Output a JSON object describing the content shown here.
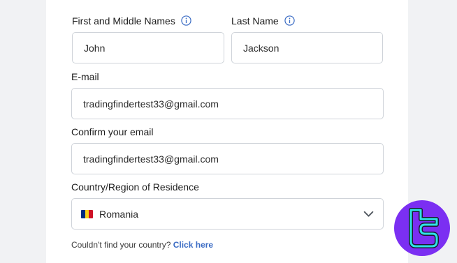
{
  "form": {
    "first_name": {
      "label": "First and Middle Names",
      "value": "John"
    },
    "last_name": {
      "label": "Last Name",
      "value": "Jackson"
    },
    "email": {
      "label": "E-mail",
      "value": "tradingfindertest33@gmail.com"
    },
    "confirm_email": {
      "label": "Confirm your email",
      "value": "tradingfindertest33@gmail.com"
    },
    "country": {
      "label": "Country/Region of Residence",
      "value": "Romania",
      "flag_colors": [
        "#002b7f",
        "#fcd116",
        "#ce1126"
      ]
    },
    "help": {
      "text": "Couldn't find your country?",
      "link": "Click here"
    }
  },
  "colors": {
    "accent": "#3b6cc4",
    "border": "#cfd3d9",
    "page_background": "#f1f2f4",
    "logo_background": "#7b2ff2",
    "logo_stroke": "#2de2e6"
  },
  "icons": {
    "info": "info-icon",
    "dropdown": "chevron-down-icon",
    "watermark": "tradingfinder-logo"
  }
}
